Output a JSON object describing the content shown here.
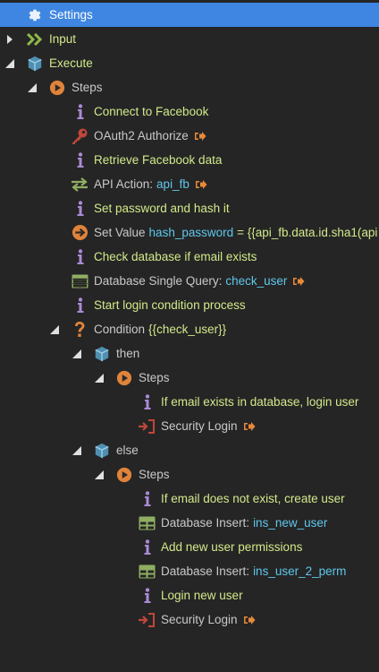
{
  "tree": {
    "settings": "Settings",
    "input": "Input",
    "execute": "Execute",
    "steps": "Steps",
    "comment_connect": "Connect to Facebook",
    "oauth_label": "OAuth2 Authorize",
    "comment_retrieve": "Retrieve Facebook data",
    "api_label": "API Action:",
    "api_value": "api_fb",
    "comment_password": "Set password and hash it",
    "setvalue_label": "Set Value",
    "setvalue_name": "hash_password",
    "setvalue_expr": "= {{api_fb.data.id.sha1(api",
    "comment_check": "Check database if email exists",
    "dbquery_label": "Database Single Query:",
    "dbquery_value": "check_user",
    "comment_start": "Start login condition process",
    "condition_label": "Condition",
    "condition_value": "{{check_user}}",
    "then": "then",
    "then_steps": "Steps",
    "comment_exists": "If email exists in database, login user",
    "security_login_1": "Security Login",
    "else": "else",
    "else_steps": "Steps",
    "comment_not_exist": "If email does not exist, create user",
    "insert1_label": "Database Insert:",
    "insert1_value": "ins_new_user",
    "comment_permissions": "Add new user permissions",
    "insert2_label": "Database Insert:",
    "insert2_value": "ins_user_2_perm",
    "comment_login_new": "Login new user",
    "security_login_2": "Security Login"
  },
  "colors": {
    "background": "#252525",
    "selected": "#3e86e1",
    "comment_text": "#d2e98a",
    "value_text": "#5fc7ec",
    "action_orange": "#e6893a",
    "info_purple": "#a98bd6",
    "server_blue": "#5a98b8",
    "db_green": "#7a9a5a"
  }
}
